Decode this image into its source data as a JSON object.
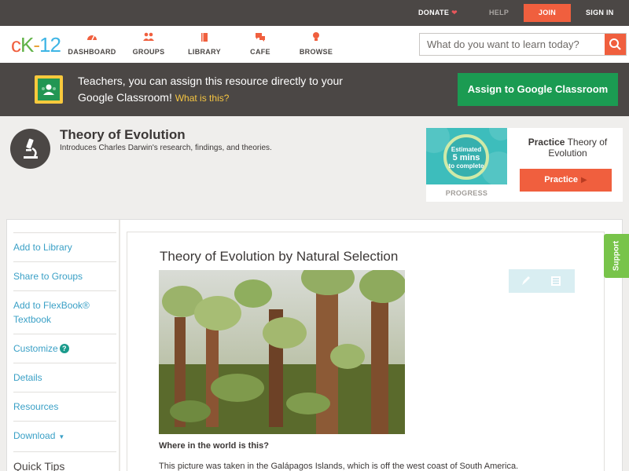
{
  "topbar": {
    "donate": "DONATE",
    "help": "HELP",
    "join": "JOIN",
    "signin": "SIGN IN"
  },
  "logo": {
    "c": "c",
    "k": "K",
    "dash": "-",
    "num": "12"
  },
  "nav": {
    "items": [
      {
        "label": "DASHBOARD",
        "icon": "dashboard-gauge-icon"
      },
      {
        "label": "GROUPS",
        "icon": "groups-people-icon"
      },
      {
        "label": "LIBRARY",
        "icon": "library-book-icon"
      },
      {
        "label": "CAFE",
        "icon": "cafe-chat-icon"
      },
      {
        "label": "BROWSE",
        "icon": "browse-bulb-icon"
      }
    ],
    "search_placeholder": "What do you want to learn today?",
    "search_icon": "search-icon"
  },
  "classroom_banner": {
    "text": "Teachers, you can assign this resource directly to your Google Classroom!",
    "what_link": "What is this?",
    "button": "Assign to Google Classroom"
  },
  "concept": {
    "title": "Theory of Evolution",
    "description": "Introduces Charles Darwin's research, findings, and theories.",
    "icon": "microscope-icon"
  },
  "practice": {
    "estimate_line1": "Estimated",
    "estimate_mins": "5 mins",
    "estimate_line3": "to complete",
    "progress_label": "PROGRESS",
    "heading_bold": "Practice",
    "heading_rest": "Theory of Evolution",
    "button": "Practice"
  },
  "sidebar": {
    "items": [
      {
        "label": "Add to Library"
      },
      {
        "label": "Share to Groups"
      },
      {
        "label": "Add to FlexBook® Textbook"
      },
      {
        "label": "Customize"
      },
      {
        "label": "Details"
      },
      {
        "label": "Resources"
      },
      {
        "label": "Download"
      }
    ],
    "customize_help": "?",
    "tips": "Quick Tips"
  },
  "article": {
    "title": "Theory of Evolution by Natural Selection",
    "question": "Where in the world is this?",
    "paragraph": "This picture was taken in the Galápagos Islands, which is off the west coast of South America."
  },
  "support_tab": "Support",
  "colors": {
    "brand_orange": "#f05f3e",
    "dark_gray": "#4b4745",
    "google_green": "#1b9b52",
    "link_blue": "#3aa0c6",
    "support_green": "#78c44a"
  }
}
